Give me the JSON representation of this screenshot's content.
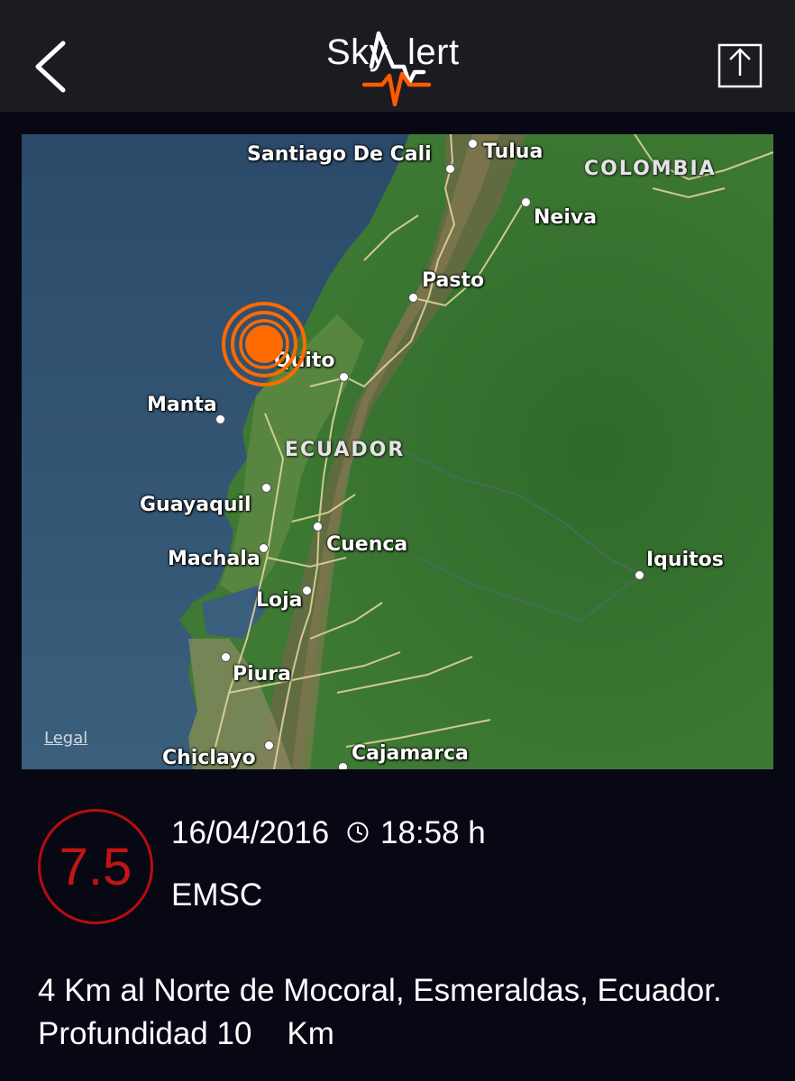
{
  "header": {
    "logo_left": "Sky",
    "logo_right": "lert",
    "back_icon": "chevron-left-icon",
    "share_icon": "share-icon",
    "logo_accent_color": "#ff5a00"
  },
  "map": {
    "cities": [
      "Santiago De Cali",
      "Tulua",
      "Neiva",
      "Pasto",
      "Quito",
      "Manta",
      "Guayaquil",
      "Cuenca",
      "Machala",
      "Loja",
      "Piura",
      "Chiclayo",
      "Cajamarca",
      "Iquitos"
    ],
    "countries": [
      "COLOMBIA",
      "ECUADOR"
    ],
    "legal": "Legal",
    "marker_color": "#ff6a00"
  },
  "quake": {
    "magnitude": "7.5",
    "magnitude_color": "#c01515",
    "date": "16/04/2016",
    "time": "18:58 h",
    "source": "EMSC",
    "location": "4 Km al Norte de Mocoral, Esmeraldas, Ecuador.",
    "depth_label": "Profundidad",
    "depth_value": "10",
    "depth_unit": "Km"
  }
}
